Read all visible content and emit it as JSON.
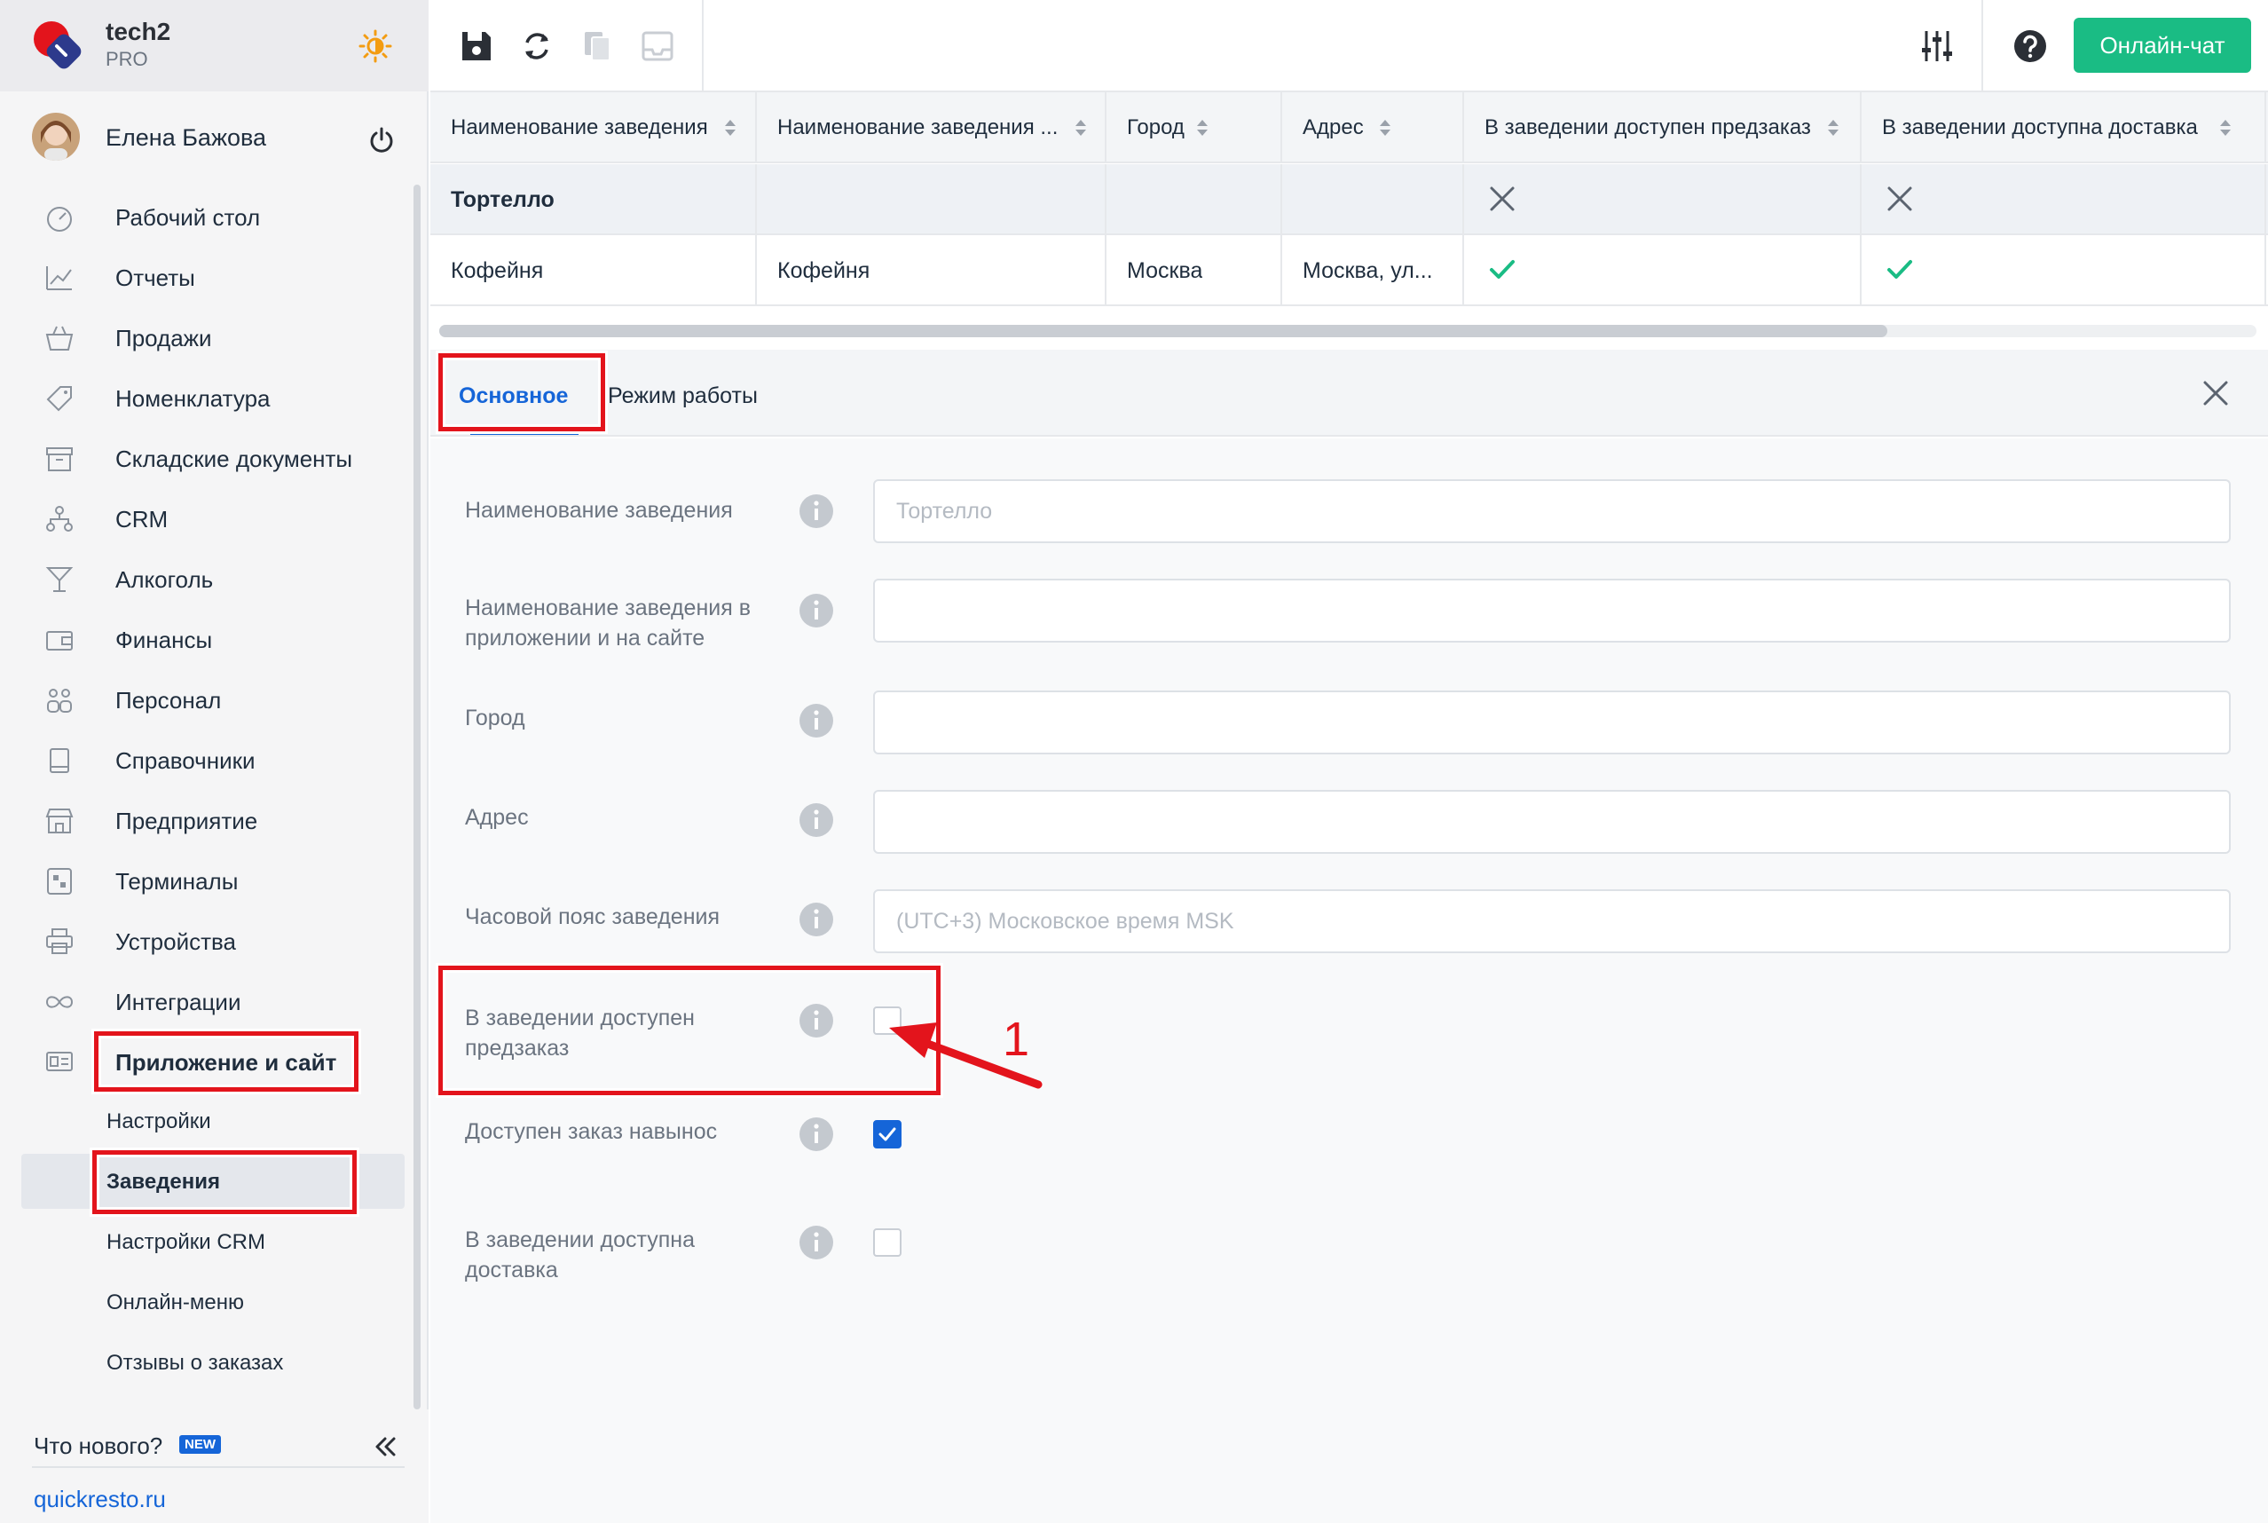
{
  "brand": {
    "name": "tech2",
    "plan": "PRO",
    "accent": "#e3141c"
  },
  "user": {
    "name": "Елена Бажова"
  },
  "sidebar": {
    "items": [
      {
        "label": "Рабочий стол",
        "icon": "speedometer-icon"
      },
      {
        "label": "Отчеты",
        "icon": "chart-icon"
      },
      {
        "label": "Продажи",
        "icon": "basket-icon"
      },
      {
        "label": "Номенклатура",
        "icon": "tag-icon"
      },
      {
        "label": "Складские документы",
        "icon": "archive-icon"
      },
      {
        "label": "CRM",
        "icon": "people-hierarchy-icon"
      },
      {
        "label": "Алкоголь",
        "icon": "cocktail-icon"
      },
      {
        "label": "Финансы",
        "icon": "wallet-icon"
      },
      {
        "label": "Персонал",
        "icon": "staff-icon"
      },
      {
        "label": "Справочники",
        "icon": "book-icon"
      },
      {
        "label": "Предприятие",
        "icon": "store-icon"
      },
      {
        "label": "Терминалы",
        "icon": "qr-terminal-icon"
      },
      {
        "label": "Устройства",
        "icon": "printer-icon"
      },
      {
        "label": "Интеграции",
        "icon": "infinity-icon"
      },
      {
        "label": "Приложение и сайт",
        "icon": "app-site-icon"
      }
    ],
    "sub_items": [
      {
        "label": "Настройки"
      },
      {
        "label": "Заведения"
      },
      {
        "label": "Настройки CRM"
      },
      {
        "label": "Онлайн-меню"
      },
      {
        "label": "Отзывы о заказах"
      }
    ],
    "whats_new": "Что нового?",
    "new_badge": "NEW",
    "site_link": "quickresto.ru"
  },
  "toolbar": {
    "chat_label": "Онлайн-чат",
    "chat_color": "#1abc84"
  },
  "table": {
    "headers": [
      "Наименование заведения",
      "Наименование заведения ...",
      "Город",
      "Адрес",
      "В заведении доступен предзаказ",
      "В заведении доступна доставка"
    ],
    "rows": [
      {
        "name": "Тортелло",
        "app_name": "",
        "city": "",
        "address": "",
        "preorder": "cross",
        "delivery": "cross"
      },
      {
        "name": "Кофейня",
        "app_name": "Кофейня",
        "city": "Москва",
        "address": "Москва, ул...",
        "preorder": "check",
        "delivery": "check"
      }
    ]
  },
  "detail": {
    "tabs": [
      "Основное",
      "Режим работы"
    ],
    "fields": {
      "name_label": "Наименование заведения",
      "name_placeholder": "Тортелло",
      "app_name_label": "Наименование заведения в приложении и на сайте",
      "city_label": "Город",
      "address_label": "Адрес",
      "timezone_label": "Часовой пояс заведения",
      "timezone_placeholder": "(UTC+3) Московское время MSK",
      "preorder_label": "В заведении доступен предзаказ",
      "preorder_checked": false,
      "takeaway_label": "Доступен заказ навынос",
      "takeaway_checked": true,
      "delivery_label": "В заведении доступна доставка",
      "delivery_checked": false
    }
  },
  "annotation": {
    "number": "1",
    "color": "#e3141c"
  }
}
